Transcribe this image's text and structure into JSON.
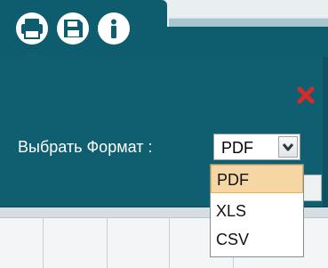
{
  "toolbar": {
    "icons": [
      "print-icon",
      "save-icon",
      "info-icon"
    ]
  },
  "dialog": {
    "format_label": "Выбрать Формат :",
    "selected_value": "PDF",
    "options": [
      "PDF",
      "XLS",
      "CSV"
    ],
    "highlighted_option": "PDF",
    "close_icon": "close-icon"
  },
  "colors": {
    "panel": "#0f5f71",
    "close": "#d42b2b",
    "highlight": "#f6d7a3"
  }
}
